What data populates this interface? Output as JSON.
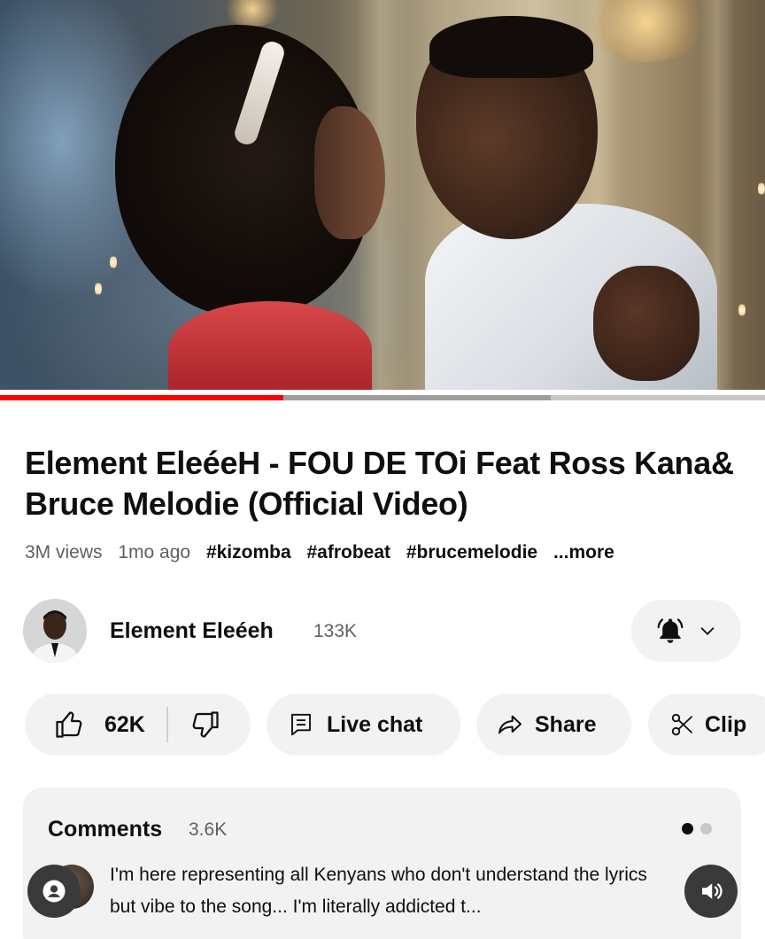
{
  "player": {
    "progress_fraction": 0.37,
    "buffered_fraction": 0.72,
    "progress_color": "#ff0000"
  },
  "video": {
    "title": "Element EleéeH - FOU DE TOi Feat Ross Kana& Bruce Melodie (Official Video)",
    "views": "3M views",
    "age": "1mo ago",
    "hashtags": [
      "#kizomba",
      "#afrobeat",
      "#brucemelodie"
    ],
    "more_label": "...more"
  },
  "channel": {
    "name": "Element Eleéeh",
    "subscribers": "133K",
    "bell_icon": "bell-icon",
    "dropdown_icon": "chevron-down-icon"
  },
  "actions": {
    "like_count": "62K",
    "like_icon": "thumbs-up-icon",
    "dislike_icon": "thumbs-down-icon",
    "live_chat_label": "Live chat",
    "share_label": "Share",
    "clip_label": "Clip"
  },
  "comments": {
    "title": "Comments",
    "count": "3.6K",
    "top_comment": "I'm here representing all Kenyans who don't understand the lyrics but vibe to the song... I'm literally addicted t..."
  },
  "colors": {
    "background": "#ffffff",
    "pill_background": "#f2f2f2",
    "secondary_text": "#606060",
    "primary_text": "#0f0f0f"
  }
}
